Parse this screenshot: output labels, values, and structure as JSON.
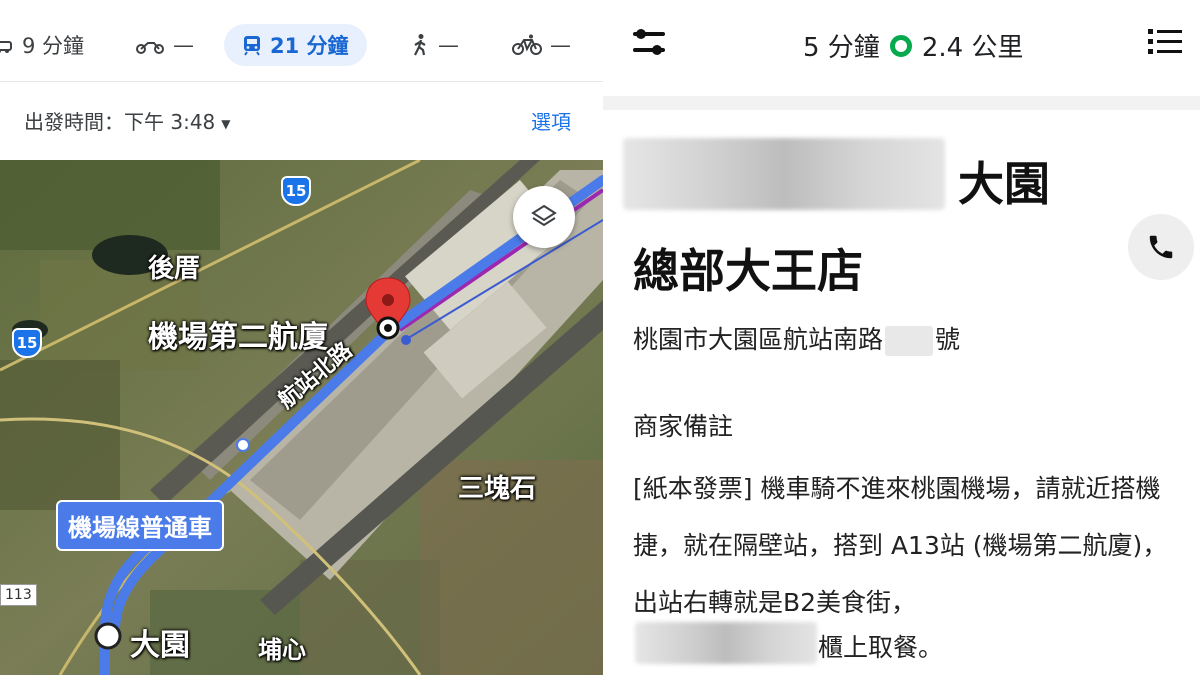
{
  "maps": {
    "modes": [
      {
        "icon": "car-icon",
        "value": "9 分鐘"
      },
      {
        "icon": "motorcycle-icon",
        "value": "—"
      },
      {
        "icon": "transit-icon",
        "value": "21 分鐘"
      },
      {
        "icon": "walk-icon",
        "value": "—"
      },
      {
        "icon": "bicycle-icon",
        "value": "—"
      }
    ],
    "departure": "出發時間：下午 3:48",
    "options": "選項",
    "labels": {
      "houcuo": "後厝",
      "terminal2": "機場第二航廈",
      "road": "航站北路",
      "sankuaishi": "三塊石",
      "dayuan": "大園",
      "puxin": "埔心",
      "transit_line": "機場線普通車",
      "edge_number": "113"
    },
    "shields": [
      "15",
      "15"
    ]
  },
  "delivery": {
    "duration": "5 分鐘",
    "distance": "2.4 公里",
    "store_name_line1": "大園",
    "store_name_line2": "總部大王店",
    "address_prefix": "桃園市大園區航站南路",
    "address_suffix": "號",
    "note_heading": "商家備註",
    "note_body": "[紙本發票] 機車騎不進來桃園機場，請就近搭機捷，就在隔壁站，搭到 A13站 (機場第二航廈)，出站右轉就是B2美食街，",
    "note_last": "櫃上取餐。"
  },
  "colors": {
    "route_blue": "#4a7be8",
    "pin_red": "#e53935",
    "accent_blue": "#1a73e8",
    "status_green": "#06a94d"
  }
}
